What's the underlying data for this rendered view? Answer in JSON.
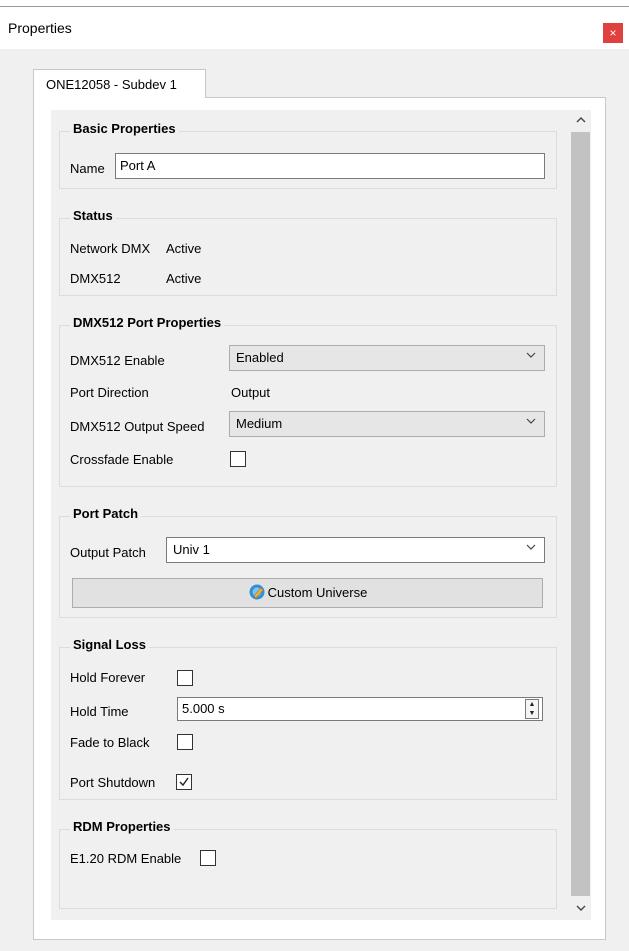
{
  "window": {
    "title": "Properties",
    "close_glyph": "×"
  },
  "tab": {
    "label": "ONE12058 - Subdev 1"
  },
  "basic": {
    "title": "Basic Properties",
    "name_label": "Name",
    "name_value": "Port A"
  },
  "status": {
    "title": "Status",
    "rows": [
      {
        "label": "Network DMX",
        "value": "Active"
      },
      {
        "label": "DMX512",
        "value": "Active"
      }
    ]
  },
  "dmx_port": {
    "title": "DMX512 Port Properties",
    "enable_label": "DMX512 Enable",
    "enable_value": "Enabled",
    "direction_label": "Port Direction",
    "direction_value": "Output",
    "speed_label": "DMX512 Output Speed",
    "speed_value": "Medium",
    "crossfade_label": "Crossfade Enable",
    "crossfade_checked": false
  },
  "port_patch": {
    "title": "Port Patch",
    "output_label": "Output Patch",
    "output_value": "Univ 1",
    "custom_button": "Custom Universe"
  },
  "signal_loss": {
    "title": "Signal Loss",
    "hold_forever_label": "Hold Forever",
    "hold_forever_checked": false,
    "hold_time_label": "Hold Time",
    "hold_time_value": "5.000 s",
    "fade_label": "Fade to Black",
    "fade_checked": false,
    "shutdown_label": "Port Shutdown",
    "shutdown_checked": true
  },
  "rdm": {
    "title": "RDM Properties",
    "enable_label": "E1.20 RDM Enable",
    "enable_checked": false
  },
  "icons": {
    "close": "close-icon",
    "chevron": "chevron-down-icon",
    "scroll_up": "scroll-up-icon",
    "scroll_down": "scroll-down-icon",
    "check": "checkmark-icon",
    "universe": "custom-universe-icon"
  },
  "colors": {
    "close_button": "#e0413f",
    "window_bg": "#f0f0f0",
    "accent_icon": "#2f8fd8"
  }
}
